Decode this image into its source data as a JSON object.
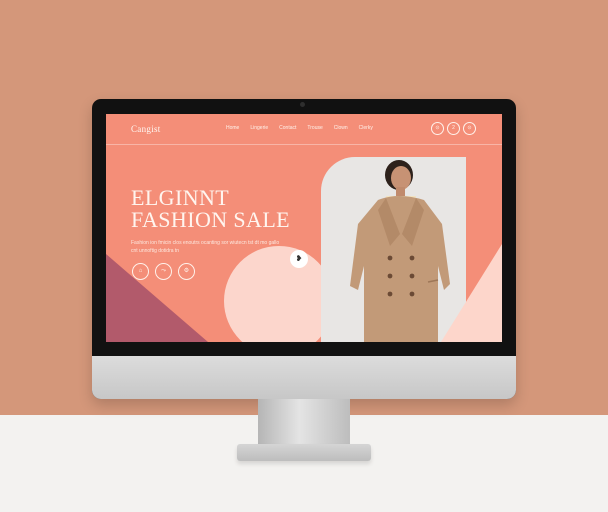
{
  "site": {
    "logo": "Cangist",
    "nav": [
      "Home",
      "Lingerie",
      "Contact",
      "Trouse",
      "Clown",
      "Clerky"
    ],
    "header_icons": [
      {
        "name": "cart-icon",
        "glyph": "⊙"
      },
      {
        "name": "user-icon",
        "glyph": "2"
      },
      {
        "name": "search-icon",
        "glyph": "⊙"
      }
    ]
  },
  "hero": {
    "title_line1": "ELGINNT",
    "title_line2": "FASHION SALE",
    "subtitle": "Fashion ion fmicin clos enoutrs ocanting sor wiutecn tst dt mo gallo cnt unnoftig dotidra tn"
  },
  "social": [
    {
      "name": "shopping-bag-icon",
      "glyph": "⌂"
    },
    {
      "name": "share-icon",
      "glyph": "⤳"
    },
    {
      "name": "settings-icon",
      "glyph": "⚙"
    }
  ],
  "bubble_glyph": "❥",
  "colors": {
    "wall": "#d4977a",
    "screen": "#f48e78",
    "mauve": "#b25a6b",
    "peach": "#fcd6cc",
    "coat": "#c29a78"
  }
}
